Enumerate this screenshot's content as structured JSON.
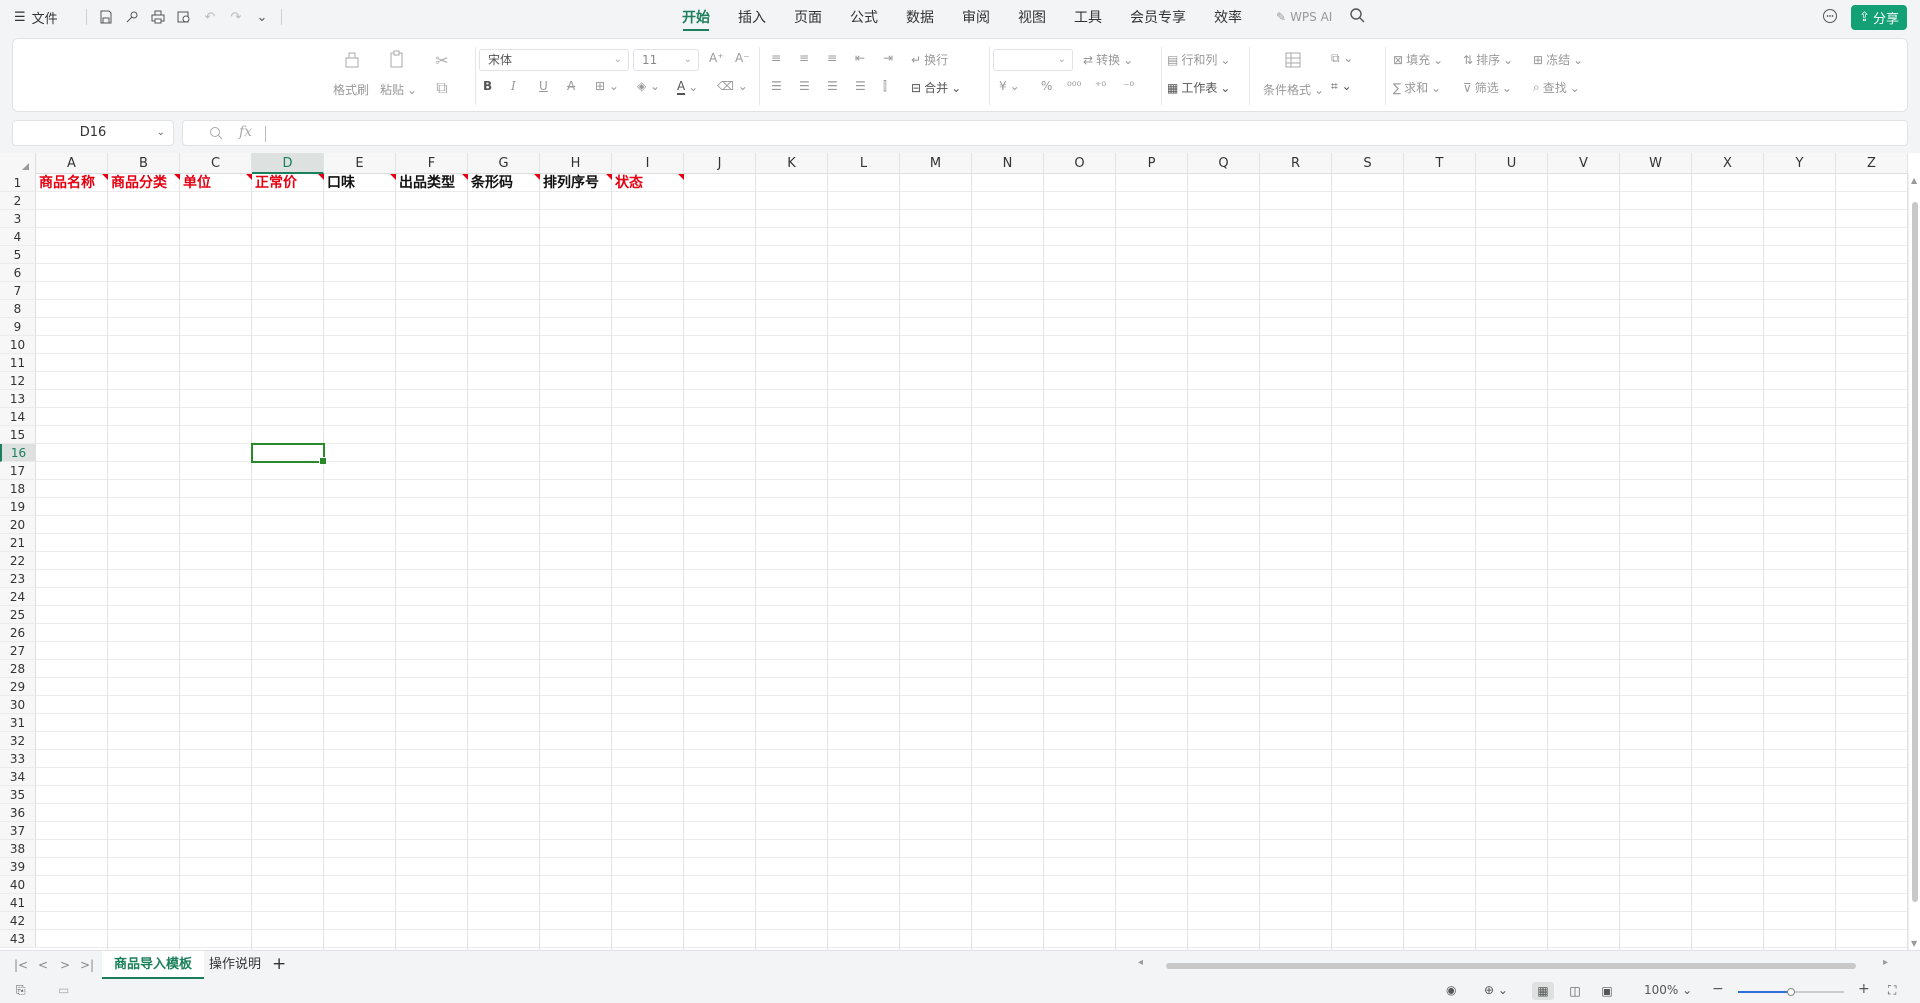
{
  "topbar": {
    "file_label": "文件",
    "tabs": [
      "开始",
      "插入",
      "页面",
      "公式",
      "数据",
      "审阅",
      "视图",
      "工具",
      "会员专享",
      "效率"
    ],
    "active_tab": "开始",
    "wps_ai": "WPS AI",
    "share_label": "分享"
  },
  "ribbon": {
    "format_painter": "格式刷",
    "paste": "粘贴",
    "font_name": "宋体",
    "font_size": "11",
    "wrap": "换行",
    "merge": "合并",
    "convert": "转换",
    "row_col": "行和列",
    "worksheet": "工作表",
    "cond_format": "条件格式",
    "fill": "填充",
    "sort": "排序",
    "freeze": "冻结",
    "sum": "求和",
    "filter": "筛选",
    "find": "查找",
    "bold": "B",
    "italic": "I",
    "underline": "U",
    "currency": "¥",
    "percent": "%"
  },
  "formula_bar": {
    "cell_ref": "D16",
    "fx": "fx",
    "value": ""
  },
  "sheet": {
    "columns": [
      "A",
      "B",
      "C",
      "D",
      "E",
      "F",
      "G",
      "H",
      "I",
      "J",
      "K",
      "L",
      "M",
      "N",
      "O",
      "P",
      "Q",
      "R",
      "S",
      "T",
      "U",
      "V",
      "W",
      "X",
      "Y",
      "Z"
    ],
    "selected_column": "D",
    "selected_row": 16,
    "row_count": 43,
    "header_row": [
      {
        "text": "商品名称",
        "required": true
      },
      {
        "text": "商品分类",
        "required": true
      },
      {
        "text": "单位",
        "required": true
      },
      {
        "text": "正常价",
        "required": true
      },
      {
        "text": "口味",
        "required": false
      },
      {
        "text": "出品类型",
        "required": false
      },
      {
        "text": "条形码",
        "required": false
      },
      {
        "text": "排列序号",
        "required": false
      },
      {
        "text": "状态",
        "required": true
      }
    ],
    "colors": {
      "required": "#e60012",
      "optional": "#111111",
      "accent": "#1a7f5a"
    }
  },
  "sheet_tabs": {
    "tabs": [
      "商品导入模板",
      "操作说明"
    ],
    "active": "商品导入模板"
  },
  "statusbar": {
    "zoom": "100%",
    "zoom_fraction": 0.5
  }
}
